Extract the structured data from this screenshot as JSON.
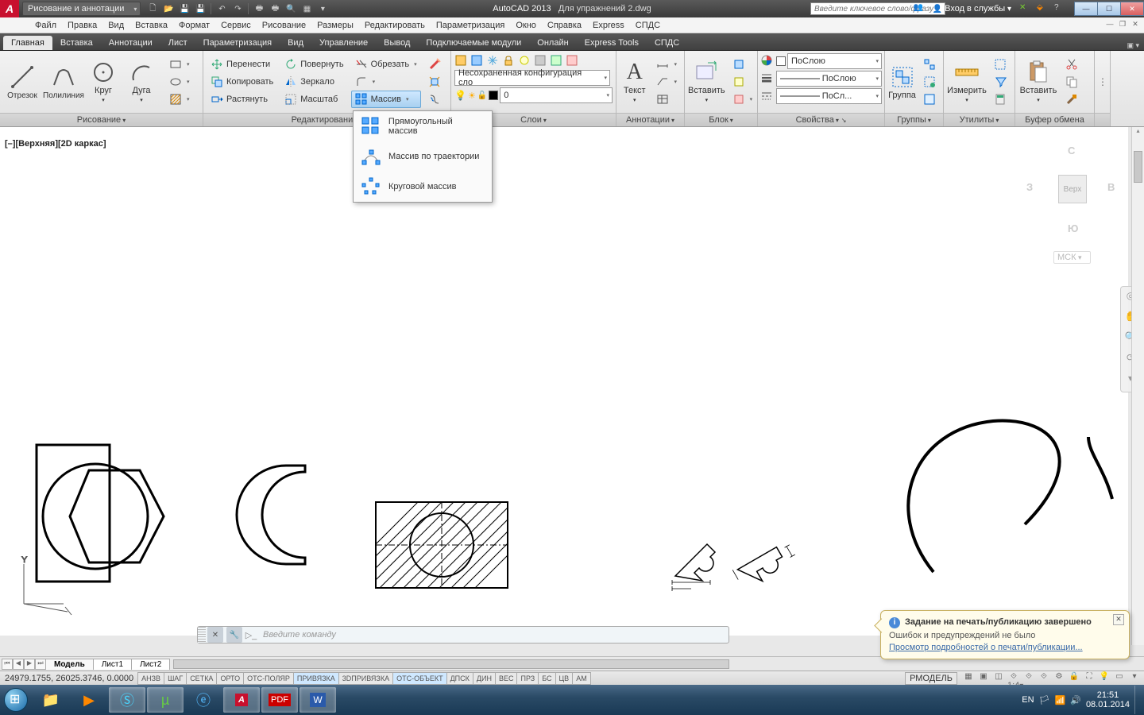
{
  "title": {
    "app": "AutoCAD 2013",
    "doc": "Для упражнений 2.dwg"
  },
  "workspace": "Рисование и аннотации",
  "search_placeholder": "Введите ключевое слово/фразу",
  "signin": "Вход в службы",
  "menus": [
    "Файл",
    "Правка",
    "Вид",
    "Вставка",
    "Формат",
    "Сервис",
    "Рисование",
    "Размеры",
    "Редактировать",
    "Параметризация",
    "Окно",
    "Справка",
    "Express",
    "СПДС"
  ],
  "ribbon_tabs": [
    "Главная",
    "Вставка",
    "Аннотации",
    "Лист",
    "Параметризация",
    "Вид",
    "Управление",
    "Вывод",
    "Подключаемые модули",
    "Онлайн",
    "Express Tools",
    "СПДС"
  ],
  "active_tab": 0,
  "panels": {
    "draw": {
      "title": "Рисование",
      "tools": [
        "Отрезок",
        "Полилиния",
        "Круг",
        "Дуга"
      ]
    },
    "modify": {
      "title": "Редактирование",
      "row1": [
        "Перенести",
        "Повернуть",
        "Обрезать"
      ],
      "row2": [
        "Копировать",
        "Зеркало"
      ],
      "row3": [
        "Растянуть",
        "Масштаб",
        "Массив"
      ]
    },
    "layers": {
      "title": "Слои",
      "unsaved": "Несохраненная конфигурация сло",
      "current": "0"
    },
    "annot": {
      "title": "Аннотации",
      "text": "Текст"
    },
    "block": {
      "title": "Блок",
      "insert": "Вставить"
    },
    "props": {
      "title": "Свойства",
      "bylayer": "ПоСлою",
      "bylayer2": "ПоСлою",
      "bylayer3": "ПоСл..."
    },
    "groups": {
      "title": "Группы",
      "group": "Группа"
    },
    "utils": {
      "title": "Утилиты",
      "measure": "Измерить"
    },
    "clip": {
      "title": "Буфер обмена",
      "paste": "Вставить"
    }
  },
  "array_menu": [
    "Прямоугольный массив",
    "Массив по траектории",
    "Круговой массив"
  ],
  "viewport_label": "[–][Верхняя][2D каркас]",
  "viewcube": {
    "n": "С",
    "s": "Ю",
    "e": "В",
    "w": "З",
    "top": "Верх",
    "wcs": "МСК"
  },
  "cmd_placeholder": "Введите команду",
  "layout_tabs": [
    "Модель",
    "Лист1",
    "Лист2"
  ],
  "coords": "24979.1755, 26025.3746, 0.0000",
  "status_toggles": [
    "АНЗВ",
    "ШАГ",
    "СЕТКА",
    "ОРТО",
    "ОТС-ПОЛЯР",
    "ПРИВЯЗКА",
    "3DПРИВЯЗКА",
    "ОТС-ОБЪЕКТ",
    "ДПСК",
    "ДИН",
    "ВЕС",
    "ПРЗ",
    "БС",
    "ЦВ",
    "АМ"
  ],
  "status_on": [
    5,
    7
  ],
  "status_right": {
    "model": "РМОДЕЛЬ",
    "scale": "1:4"
  },
  "balloon": {
    "title": "Задание на печать/публикацию завершено",
    "text": "Ошибок и предупреждений не было",
    "link": "Просмотр подробностей о печати/публикации..."
  },
  "tray": {
    "lang": "EN",
    "time": "21:51",
    "date": "08.01.2014"
  }
}
